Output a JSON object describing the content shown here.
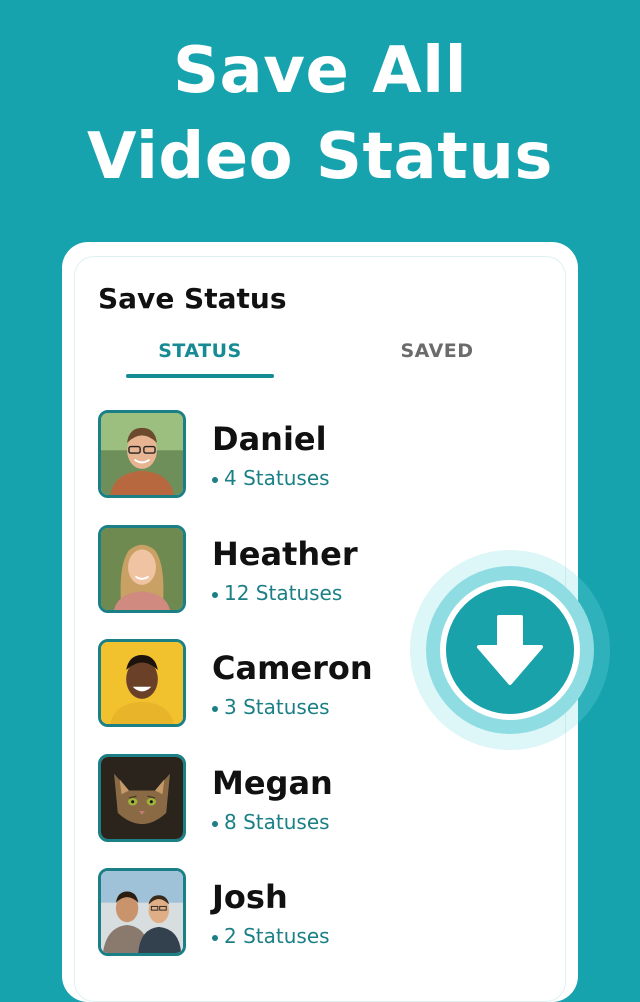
{
  "headline": {
    "line1": "Save All",
    "line2": "Video Status"
  },
  "card": {
    "title": "Save Status",
    "tabs": [
      {
        "label": "STATUS",
        "active": true
      },
      {
        "label": "SAVED",
        "active": false
      }
    ],
    "contacts": [
      {
        "name": "Daniel",
        "count": "4 Statuses"
      },
      {
        "name": "Heather",
        "count": "12 Statuses"
      },
      {
        "name": "Cameron",
        "count": "3 Statuses"
      },
      {
        "name": "Megan",
        "count": "8 Statuses"
      },
      {
        "name": "Josh",
        "count": "2 Statuses"
      }
    ]
  },
  "fab": {
    "icon": "download-arrow-icon"
  },
  "colors": {
    "background": "#17A3AE",
    "accent": "#1B7F86",
    "fab": "#1AA2AB"
  }
}
